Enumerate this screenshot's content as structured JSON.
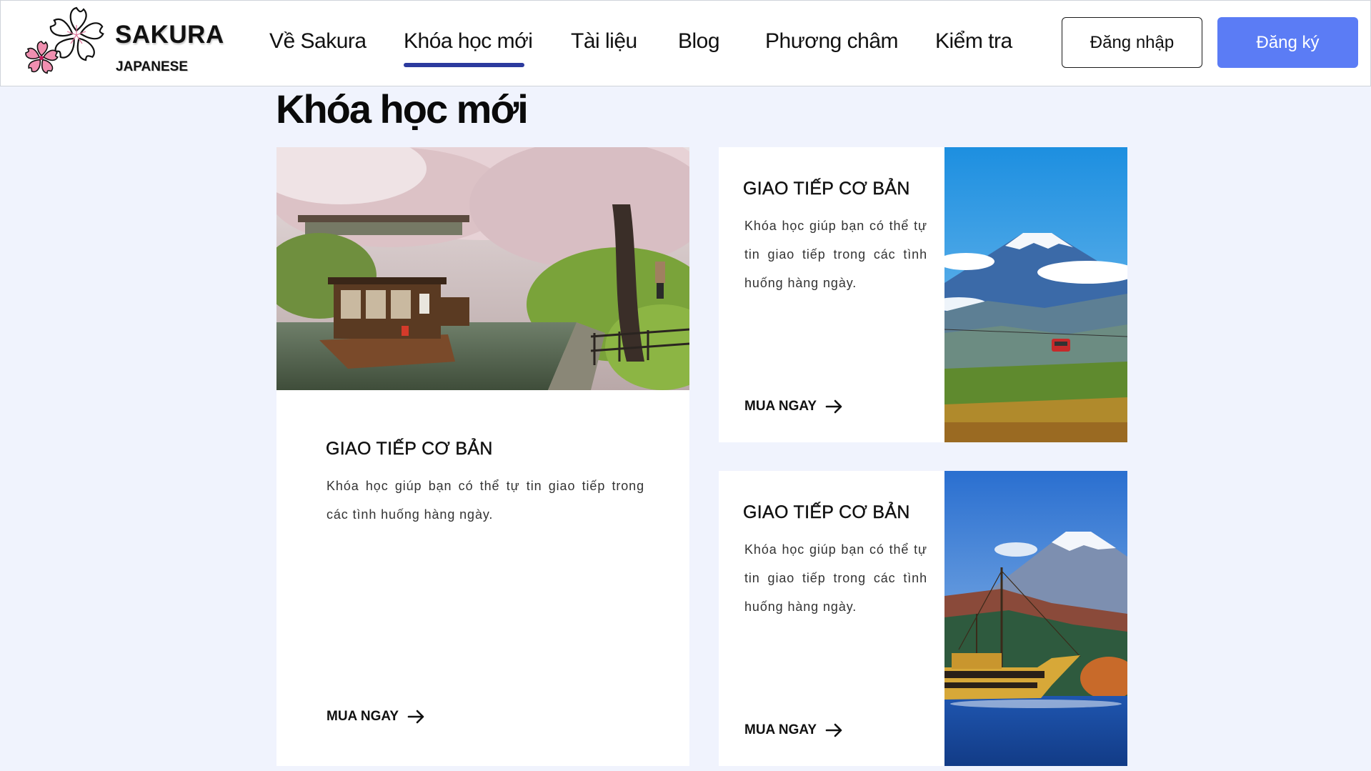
{
  "brand": {
    "name": "SAKURA",
    "sub": "JAPANESE"
  },
  "nav": {
    "items": [
      "Về Sakura",
      "Khóa học mới",
      "Tài liệu",
      "Blog",
      "Phương châm",
      "Kiểm tra"
    ],
    "active_index": 1
  },
  "auth": {
    "login_label": "Đăng nhập",
    "signup_label": "Đăng ký"
  },
  "colors": {
    "accent": "#5b7cf5",
    "active_underline": "#2c3a9e",
    "background": "#f0f3fd"
  },
  "main": {
    "title": "Khóa học mới",
    "courses": [
      {
        "title": "GIAO TIẾP CƠ BẢN",
        "desc": "Khóa học giúp bạn có thể tự tin giao tiếp trong các tình huống hàng ngày.",
        "cta": "MUA NGAY",
        "image": "cherry-blossom-canal-boat-photo"
      },
      {
        "title": "GIAO TIẾP CƠ BẢN",
        "desc": "Khóa học giúp bạn có thể tự tin giao tiếp trong các tình huống hàng ngày.",
        "cta": "MUA NGAY",
        "image": "mount-fuji-ropeway-photo"
      },
      {
        "title": "GIAO TIẾP CƠ BẢN",
        "desc": "Khóa học giúp bạn có thể tự tin giao tiếp trong các tình huống hàng ngày.",
        "cta": "MUA NGAY",
        "image": "mount-fuji-pirate-ship-photo"
      }
    ]
  }
}
